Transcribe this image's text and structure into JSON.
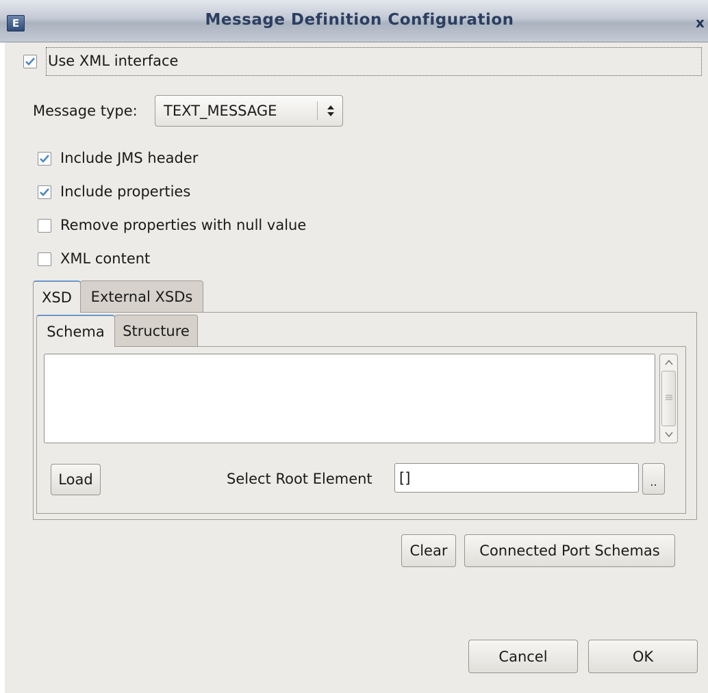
{
  "window": {
    "title": "Message Definition Configuration",
    "icon_glyph": "E",
    "close_glyph": "x"
  },
  "use_xml": {
    "label": "Use XML interface",
    "checked": true
  },
  "message_type": {
    "label": "Message type:",
    "value": "TEXT_MESSAGE"
  },
  "options": [
    {
      "label": "Include JMS header",
      "checked": true
    },
    {
      "label": "Include properties",
      "checked": true
    },
    {
      "label": "Remove properties with null value",
      "checked": false
    },
    {
      "label": "XML content",
      "checked": false
    }
  ],
  "outer_tabs": [
    {
      "label": "XSD",
      "active": true
    },
    {
      "label": "External XSDs",
      "active": false
    }
  ],
  "inner_tabs": [
    {
      "label": "Schema",
      "active": true
    },
    {
      "label": "Structure",
      "active": false
    }
  ],
  "schema_text": "",
  "load_button": "Load",
  "root_element": {
    "label": "Select Root Element",
    "value": "[]",
    "browse_label": ".."
  },
  "clear_button": "Clear",
  "connected_button": "Connected Port Schemas",
  "cancel_button": "Cancel",
  "ok_button": "OK",
  "colors": {
    "dialog_bg": "#edebe7",
    "check_color": "#4f86c6",
    "title_text": "#2c3e60",
    "active_tab_accent": "#6a95c9"
  }
}
